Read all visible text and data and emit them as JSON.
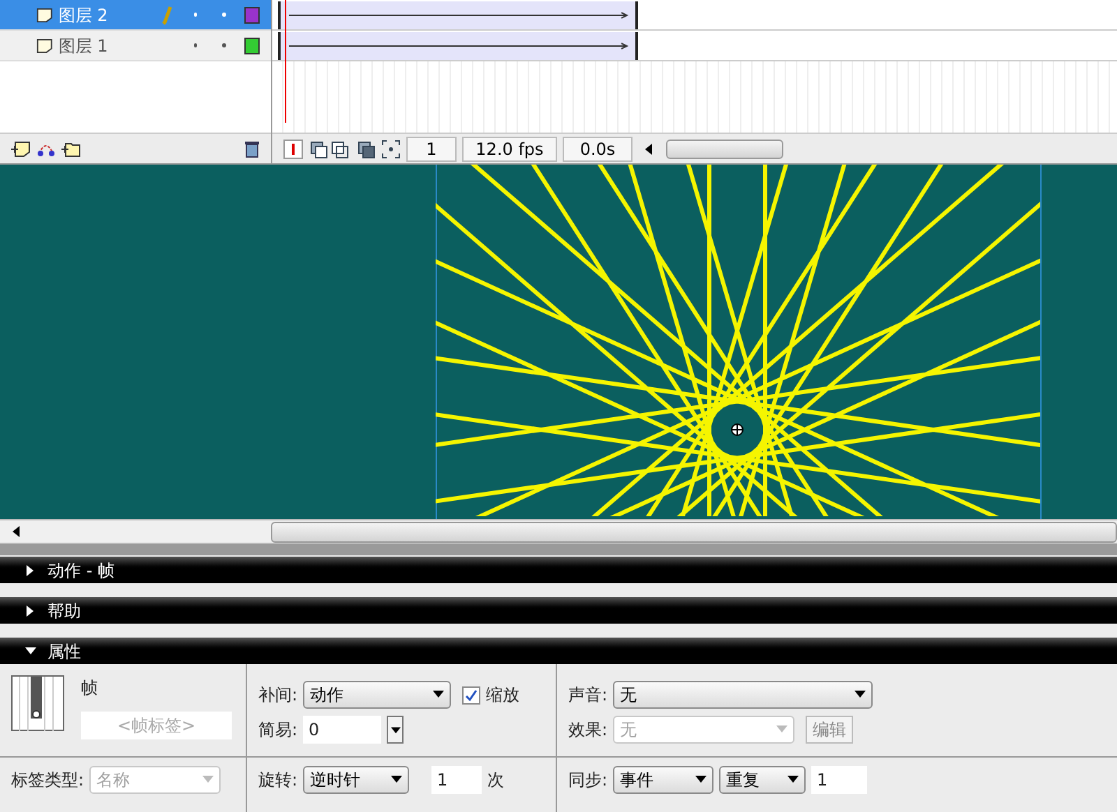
{
  "layers": [
    {
      "name": "图层 2",
      "selected": true,
      "editing": true,
      "color": "#9933cc"
    },
    {
      "name": "图层 1",
      "selected": false,
      "editing": false,
      "color": "#33cc33"
    }
  ],
  "timeline": {
    "frame": "1",
    "fps": "12.0 fps",
    "time": "0.0s"
  },
  "panels": [
    {
      "title": "动作 - 帧",
      "expanded": false
    },
    {
      "title": "帮助",
      "expanded": false
    },
    {
      "title": "属性",
      "expanded": true
    }
  ],
  "properties": {
    "type_label": "帧",
    "frame_label": {
      "placeholder": "<帧标签>"
    },
    "label_type": {
      "label": "标签类型:",
      "value": "名称",
      "disabled": true
    },
    "tween": {
      "label": "补间:",
      "value": "动作"
    },
    "scale": {
      "label": "缩放",
      "checked": true
    },
    "ease": {
      "label": "简易:",
      "value": "0"
    },
    "rotate": {
      "label": "旋转:",
      "value": "逆时针",
      "count": "1",
      "unit": "次"
    },
    "sound": {
      "label": "声音:",
      "value": "无"
    },
    "effect": {
      "label": "效果:",
      "value": "无",
      "disabled": true,
      "button": "编辑"
    },
    "sync": {
      "label": "同步:",
      "value": "事件",
      "repeat": "重复",
      "count": "1"
    }
  }
}
